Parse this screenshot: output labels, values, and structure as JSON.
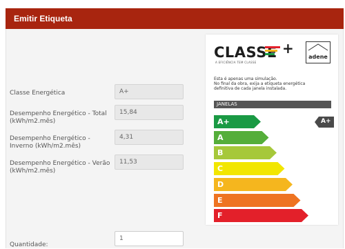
{
  "header": {
    "title": "Emitir Etiqueta"
  },
  "form": {
    "classe_label": "Classe Energética",
    "classe_value": "A+",
    "total_label_1": "Desempenho Energético - Total",
    "total_label_2": "(kWh/m2.mês)",
    "total_value": "15,84",
    "inverno_label_1": "Desempenho Energético -",
    "inverno_label_2": "Inverno (kWh/m2.mês)",
    "inverno_value": "4,31",
    "verao_label_1": "Desempenho Energético - Verão",
    "verao_label_2": "(kWh/m2.mês)",
    "verao_value": "11,53",
    "quantidade_label": "Quantidade:",
    "quantidade_value": "1"
  },
  "label_card": {
    "logo_text": "CLASSE",
    "logo_plus": "+",
    "tagline": "A EFICIÊNCIA TEM CLASSE",
    "adene_text": "adene",
    "simulation_note": [
      "Esta é apenas uma simulação.",
      "No final da obra, exija a etiqueta energética",
      "definitiva de cada janela instalada."
    ],
    "section_title": "JANELAS",
    "current_class": "A+",
    "ratings": [
      {
        "label": "A+",
        "color": "#1a9a44"
      },
      {
        "label": "A",
        "color": "#55ae3a"
      },
      {
        "label": "B",
        "color": "#a6c83a"
      },
      {
        "label": "C",
        "color": "#f2e600"
      },
      {
        "label": "D",
        "color": "#f5b61e"
      },
      {
        "label": "E",
        "color": "#ee7422"
      },
      {
        "label": "F",
        "color": "#e3202a"
      }
    ],
    "indicator_color": "#4a4a4a"
  }
}
